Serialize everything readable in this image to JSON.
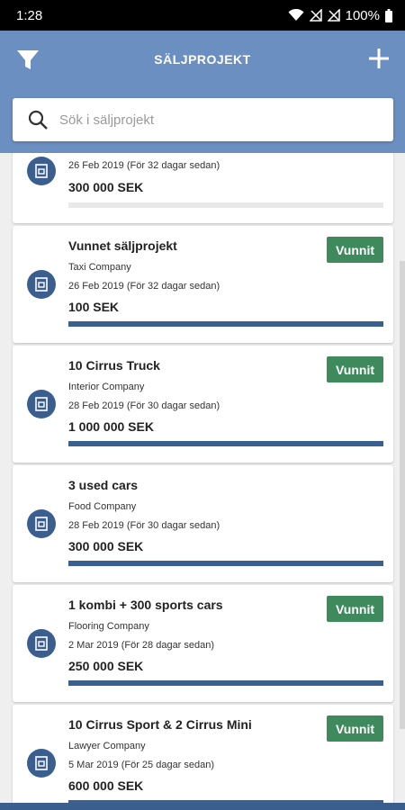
{
  "status_bar": {
    "time": "1:28",
    "battery": "100%"
  },
  "app_bar": {
    "title": "SÄLJPROJEKT"
  },
  "search": {
    "placeholder": "Sök i säljprojekt"
  },
  "colors": {
    "header": "#6b8fc0",
    "accent": "#3a5f8f",
    "won_badge": "#3e8a5c"
  },
  "projects": [
    {
      "title": "",
      "company": "",
      "date": "26 Feb 2019 (För 32 dagar sedan)",
      "amount": "300 000 SEK",
      "status": "",
      "progress": 0
    },
    {
      "title": "Vunnet säljprojekt",
      "company": "Taxi Company",
      "date": "26 Feb 2019 (För 32 dagar sedan)",
      "amount": "100 SEK",
      "status": "Vunnit",
      "progress": 1
    },
    {
      "title": "10 Cirrus Truck",
      "company": "Interior Company",
      "date": "28 Feb 2019 (För 30 dagar sedan)",
      "amount": "1 000 000 SEK",
      "status": "Vunnit",
      "progress": 1
    },
    {
      "title": "3 used cars",
      "company": "Food Company",
      "date": "28 Feb 2019 (För 30 dagar sedan)",
      "amount": "300 000 SEK",
      "status": "",
      "progress": 1
    },
    {
      "title": "1 kombi + 300 sports cars",
      "company": "Flooring Company",
      "date": "2 Mar 2019 (För 28 dagar sedan)",
      "amount": "250 000 SEK",
      "status": "Vunnit",
      "progress": 1
    },
    {
      "title": "10 Cirrus Sport & 2 Cirrus Mini",
      "company": "Lawyer Company",
      "date": "5 Mar 2019 (För 25 dagar sedan)",
      "amount": "600 000 SEK",
      "status": "Vunnit",
      "progress": 1
    }
  ]
}
